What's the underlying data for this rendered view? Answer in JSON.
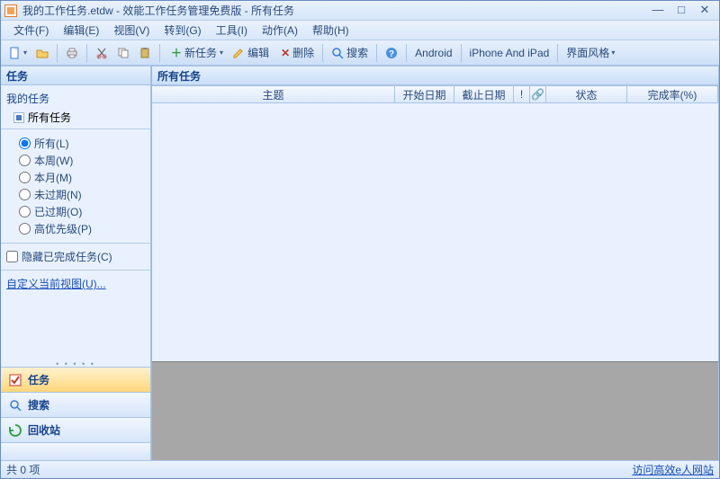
{
  "window": {
    "title": "我的工作任务.etdw - 效能工作任务管理免费版 - 所有任务"
  },
  "menu": {
    "file": "文件(F)",
    "edit": "编辑(E)",
    "view": "视图(V)",
    "goto": "转到(G)",
    "tools": "工具(I)",
    "action": "动作(A)",
    "help": "帮助(H)"
  },
  "toolbar": {
    "new_task": "新任务",
    "edit_btn": "编辑",
    "delete_btn": "删除",
    "search": "搜索",
    "android": "Android",
    "iphone": "iPhone And iPad",
    "skin": "界面风格"
  },
  "sidebar": {
    "header": "任务",
    "root": "我的任务",
    "all_tasks": "所有任务",
    "filters": {
      "all": "所有(L)",
      "week": "本周(W)",
      "month": "本月(M)",
      "not_overdue": "未过期(N)",
      "overdue": "已过期(O)",
      "high_priority": "高优先级(P)"
    },
    "hide_done": "隐藏已完成任务(C)",
    "custom_view": "自定义当前视图(U)...",
    "nav": {
      "tasks": "任务",
      "search": "搜索",
      "recycle": "回收站"
    }
  },
  "main": {
    "header": "所有任务",
    "cols": {
      "subject": "主题",
      "start": "开始日期",
      "due": "截止日期",
      "priority": "!",
      "attach": "📎",
      "status": "状态",
      "percent": "完成率(%)"
    }
  },
  "status": {
    "count": "共 0 项",
    "link": "访问高效e人网站"
  }
}
